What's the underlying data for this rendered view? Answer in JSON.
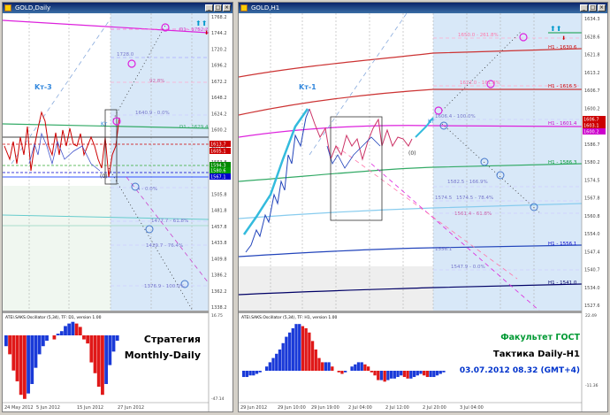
{
  "left": {
    "title": "GOLD,Daily",
    "cta_arrows": "⬆⬆",
    "cta_red_arrow": "⬇",
    "labels": {
      "kt3": "Kт-3",
      "kt_small": "Kт",
      "zero": "(0)",
      "lvl_top": "D1 - 1752.2",
      "lvl_1728": "1728.0",
      "lvl_1720": "92.8%",
      "lvl_1640": "1640.9 - 0.0%",
      "lvl_d1_1629": "D1 - 1629.4",
      "lvl_1585": "4 - 0.0%",
      "lvl_1480": "1477.7 - 61.8%",
      "lvl_1433": "1429.7 - 76.4%",
      "lvl_1380": "1376.9 - 100.0%"
    },
    "price_axis": [
      "1768.2",
      "1744.2",
      "1720.2",
      "1696.2",
      "1672.2",
      "1648.2",
      "1624.2",
      "1600.2",
      "1577.8",
      "1553.8",
      "1529.8",
      "1505.8",
      "1481.8",
      "1457.8",
      "1433.8",
      "1409.8",
      "1386.2",
      "1362.2",
      "1338.2"
    ],
    "price_tags": [
      {
        "text": "1613.7",
        "color": "#cc0000"
      },
      {
        "text": "1605.1",
        "color": "#cc0000"
      },
      {
        "text": "1594.3",
        "color": "#008800"
      },
      {
        "text": "1580.6",
        "color": "#009900"
      },
      {
        "text": "1567.1",
        "color": "#0000cc"
      }
    ],
    "osc_title": "ATEI.SAKS.Oscillator (5,34), TF: D1, version 1.00",
    "osc_axis": [
      "16.75",
      "-47.14"
    ],
    "strategy_line1": "Стратегия",
    "strategy_line2": "Monthly-Daily",
    "time_axis": [
      "24 May 2012",
      "5 Jun 2012",
      "15 Jun 2012",
      "27 Jun 2012"
    ],
    "osc_values": [
      -8,
      -14,
      -26,
      -34,
      -44,
      -47,
      -43,
      -36,
      -24,
      -14,
      -8,
      -4,
      0,
      -3,
      2,
      5,
      11,
      14,
      16,
      14,
      10,
      -3,
      -6,
      -20,
      -28,
      -38,
      -44,
      -36,
      -22,
      -12,
      -4
    ]
  },
  "right": {
    "title": "GOLD,H1",
    "cta_arrows": "⬆⬆",
    "cta_red_arrow": "⬇",
    "labels": {
      "kt1": "Kт-1",
      "kt_small": "Kт",
      "zero": "(0)",
      "lvl_1650": "1650.0 - 261.8%",
      "lvl_1622": "1622.0 - 161.8%",
      "lvl_1621": "1621.2",
      "lvl_1606": "1606.4 - 100.0%",
      "lvl_1582": "1582.5 - 166.9%",
      "lvl_1574": "1574.5",
      "lvl_1574b": "1574.5 - 78.4%",
      "lvl_1561": "1561.4 - 61.8%",
      "lvl_1556": "1556.1",
      "lvl_1547": "1547.9 - 0.0%"
    },
    "h1_levels": [
      {
        "text": "H1 - 1630.6",
        "color": "#cc0000"
      },
      {
        "text": "H1 - 1616.5",
        "color": "#cc0000"
      },
      {
        "text": "H1 - 1601.4",
        "color": "#cc00cc"
      },
      {
        "text": "H1 - 1586.3",
        "color": "#009933"
      },
      {
        "text": "H1 - 1556.1",
        "color": "#0000cc"
      },
      {
        "text": "H1 - 1541.0",
        "color": "#000066"
      }
    ],
    "price_axis": [
      "1634.3",
      "1628.6",
      "1621.8",
      "1613.2",
      "1606.7",
      "1600.2",
      "1594.1",
      "1586.7",
      "1580.2",
      "1574.5",
      "1567.8",
      "1560.8",
      "1554.0",
      "1547.4",
      "1540.7",
      "1534.0",
      "1527.6"
    ],
    "price_tags": [
      {
        "text": "1606.7",
        "color": "#cc0000"
      },
      {
        "text": "1603.1",
        "color": "#cc0000"
      },
      {
        "text": "1600.2",
        "color": "#cc00cc"
      }
    ],
    "osc_title": "ATEI.SAKS.Oscillator (5,34), TF: H1, version 1.00",
    "osc_axis": [
      "22.49",
      "-11.36"
    ],
    "faculty": "Факультет ГОСТ",
    "tactic": "Тактика Daily-H1",
    "datetime": "03.07.2012   08.32 (GMT+4)",
    "time_axis": [
      "29 Jun 2012",
      "29 Jun 10:00",
      "29 Jun 19:00",
      "2 Jul 04:00",
      "2 Jul 12:00",
      "2 Jul 20:00",
      "3 Jul 04:00"
    ],
    "osc_values": [
      -4,
      -4,
      -3,
      -3,
      -2,
      -1,
      0,
      2,
      4,
      6,
      8,
      10,
      13,
      16,
      18,
      20,
      22,
      22,
      21,
      20,
      18,
      14,
      10,
      6,
      4,
      4,
      4,
      2,
      0,
      -1,
      -2,
      -1,
      0,
      2,
      3,
      4,
      4,
      3,
      2,
      -1,
      -3,
      -6,
      -6,
      -7,
      -6,
      -5,
      -5,
      -4,
      -3,
      -4,
      -5,
      -5,
      -4,
      -3,
      -2,
      -3,
      -4,
      -4,
      -4,
      -3,
      -2,
      -1
    ]
  }
}
